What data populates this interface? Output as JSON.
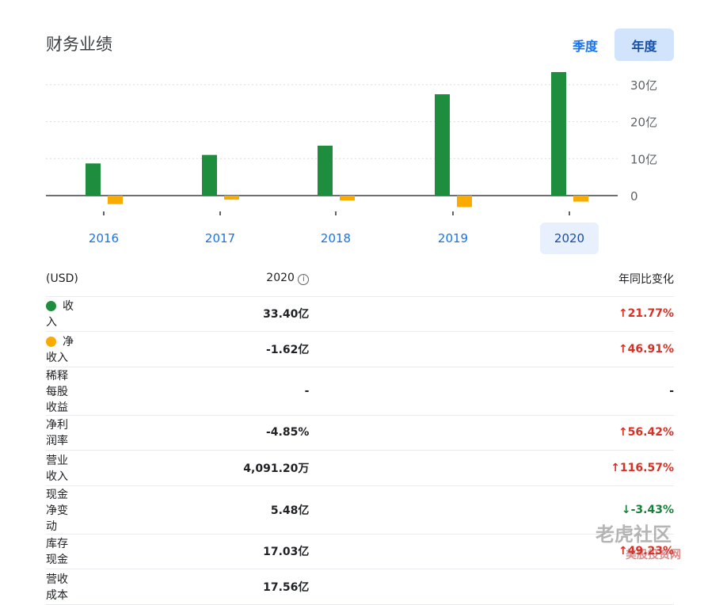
{
  "header": {
    "title": "财务业绩",
    "tabs": [
      "季度",
      "年度"
    ],
    "selected_tab": "年度"
  },
  "chart_data": {
    "type": "bar",
    "categories": [
      "2016",
      "2017",
      "2018",
      "2019",
      "2020"
    ],
    "selected_category": "2020",
    "series": [
      {
        "name": "收入",
        "color": "#1e8e3e",
        "values": [
          8.7,
          11.0,
          13.5,
          27.4,
          33.4
        ]
      },
      {
        "name": "净收入",
        "color": "#f9ab00",
        "values": [
          -2.3,
          -1.1,
          -1.3,
          -3.1,
          -1.62
        ]
      }
    ],
    "yticks": [
      {
        "v": 0,
        "label": "0"
      },
      {
        "v": 10,
        "label": "10亿"
      },
      {
        "v": 20,
        "label": "20亿"
      },
      {
        "v": 30,
        "label": "30亿"
      }
    ],
    "ylim": [
      -4,
      34
    ],
    "unit": "亿 USD",
    "grid": true
  },
  "table": {
    "headers": [
      "(USD)",
      "2020",
      "年同比变化"
    ],
    "rows": [
      {
        "label": "收入",
        "dot": "#1e8e3e",
        "value": "33.40亿",
        "change": "↑21.77%",
        "dir": "up"
      },
      {
        "label": "净收入",
        "dot": "#f9ab00",
        "value": "-1.62亿",
        "change": "↑46.91%",
        "dir": "up"
      },
      {
        "label": "稀释每股收益",
        "value": "-",
        "change": "-",
        "dir": ""
      },
      {
        "label": "净利润率",
        "value": "-4.85%",
        "change": "↑56.42%",
        "dir": "up"
      },
      {
        "label": "营业收入",
        "value": "4,091.20万",
        "change": "↑116.57%",
        "dir": "up"
      },
      {
        "label": "现金净变动",
        "value": "5.48亿",
        "change": "↓-3.43%",
        "dir": "down"
      },
      {
        "label": "库存现金",
        "value": "17.03亿",
        "change": "↑49.23%",
        "dir": "up"
      },
      {
        "label": "营收成本",
        "value": "17.56亿",
        "change": "",
        "dir": ""
      }
    ]
  },
  "watermark": {
    "line1": "老虎社区",
    "line2": "美股投资网"
  }
}
